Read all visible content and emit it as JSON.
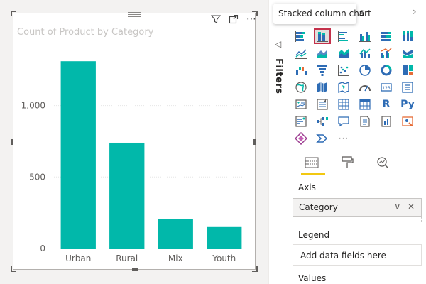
{
  "tooltip": {
    "text": "Stacked column chart"
  },
  "visual": {
    "title": "Count of Product by Category",
    "toolbar": [
      {
        "name": "filter-icon",
        "glyph": "⊽"
      },
      {
        "name": "focus-mode-icon",
        "glyph": "⤢"
      },
      {
        "name": "more-options-icon",
        "glyph": "⋯"
      }
    ]
  },
  "chart_data": {
    "type": "bar",
    "title": "Count of Product by Category",
    "categories": [
      "Urban",
      "Rural",
      "Mix",
      "Youth"
    ],
    "values": [
      1310,
      740,
      205,
      150
    ],
    "ylim": [
      0,
      1450
    ],
    "yticks": [
      0,
      500,
      1000
    ],
    "ytick_labels": [
      "0",
      "500",
      "1,000"
    ],
    "grid": true,
    "bar_color": "#01b8aa"
  },
  "filters": {
    "label": "Filters",
    "arrow": "◁"
  },
  "viz_pane": {
    "header_partial": "s",
    "chevron": "›",
    "icons": [
      "stacked-bar-chart-icon",
      "stacked-column-chart-icon",
      "clustered-bar-chart-icon",
      "clustered-column-chart-icon",
      "100-stacked-bar-chart-icon",
      "100-stacked-column-chart-icon",
      "line-chart-icon",
      "area-chart-icon",
      "stacked-area-chart-icon",
      "line-and-stacked-column-chart-icon",
      "line-and-clustered-column-chart-icon",
      "ribbon-chart-icon",
      "waterfall-chart-icon",
      "funnel-chart-icon",
      "scatter-chart-icon",
      "pie-chart-icon",
      "donut-chart-icon",
      "treemap-icon",
      "map-icon",
      "filled-map-icon",
      "shape-map-icon",
      "gauge-icon",
      "card-icon",
      "multi-row-card-icon",
      "kpi-icon",
      "slicer-icon",
      "table-icon",
      "matrix-icon",
      "r-script-visual-icon",
      "python-visual-icon",
      "key-influencers-icon",
      "decomposition-tree-icon",
      "qa-icon",
      "smart-narrative-icon",
      "paginated-report-icon",
      "arcgis-map-icon",
      "power-apps-icon",
      "power-automate-icon",
      "get-more-visuals-icon"
    ],
    "icon_text": {
      "r": "R",
      "py": "Py",
      "more": "···"
    },
    "selected_icon": "stacked-column-chart-icon",
    "tabs": [
      "fields-tab",
      "format-tab",
      "analytics-tab"
    ],
    "axis": {
      "label": "Axis",
      "field": "Category",
      "actions": "∨ ✕"
    },
    "legend": {
      "label": "Legend",
      "placeholder": "Add data fields here"
    },
    "values": {
      "label": "Values"
    }
  }
}
